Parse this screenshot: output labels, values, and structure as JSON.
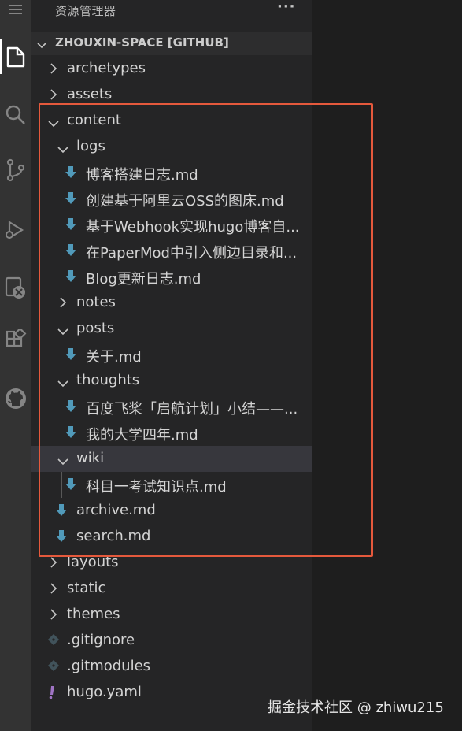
{
  "explorer": {
    "title": "资源管理器",
    "more_icon": "ellipsis-icon",
    "section_title": "ZHOUXIN-SPACE [GITHUB]"
  },
  "activity_bar": {
    "icons": [
      "menu-icon",
      "files-icon",
      "search-icon",
      "source-control-icon",
      "run-debug-icon",
      "remote-icon",
      "extensions-icon",
      "github-icon"
    ]
  },
  "tree": [
    {
      "name": "archetypes",
      "type": "folder",
      "expanded": false,
      "depth": 0
    },
    {
      "name": "assets",
      "type": "folder",
      "expanded": false,
      "depth": 0
    },
    {
      "name": "content",
      "type": "folder",
      "expanded": true,
      "depth": 0
    },
    {
      "name": "logs",
      "type": "folder",
      "expanded": true,
      "depth": 1
    },
    {
      "name": "博客搭建日志.md",
      "type": "md",
      "depth": 2
    },
    {
      "name": "创建基于阿里云OSS的图床.md",
      "type": "md",
      "depth": 2
    },
    {
      "name": "基于Webhook实现hugo博客自...",
      "type": "md",
      "depth": 2
    },
    {
      "name": "在PaperMod中引入侧边目录和...",
      "type": "md",
      "depth": 2
    },
    {
      "name": "Blog更新日志.md",
      "type": "md",
      "depth": 2
    },
    {
      "name": "notes",
      "type": "folder",
      "expanded": false,
      "depth": 1
    },
    {
      "name": "posts",
      "type": "folder",
      "expanded": true,
      "depth": 1
    },
    {
      "name": "关于.md",
      "type": "md",
      "depth": 2
    },
    {
      "name": "thoughts",
      "type": "folder",
      "expanded": true,
      "depth": 1
    },
    {
      "name": "百度飞桨「启航计划」小结——...",
      "type": "md",
      "depth": 2
    },
    {
      "name": "我的大学四年.md",
      "type": "md",
      "depth": 2
    },
    {
      "name": "wiki",
      "type": "folder",
      "expanded": true,
      "depth": 1,
      "selected": true
    },
    {
      "name": "科目一考试知识点.md",
      "type": "md",
      "depth": 2,
      "guide": true
    },
    {
      "name": "archive.md",
      "type": "md",
      "depth": 1
    },
    {
      "name": "search.md",
      "type": "md",
      "depth": 1
    },
    {
      "name": "layouts",
      "type": "folder",
      "expanded": false,
      "depth": 0
    },
    {
      "name": "static",
      "type": "folder",
      "expanded": false,
      "depth": 0
    },
    {
      "name": "themes",
      "type": "folder",
      "expanded": false,
      "depth": 0
    },
    {
      "name": ".gitignore",
      "type": "git",
      "depth": 0
    },
    {
      "name": ".gitmodules",
      "type": "git",
      "depth": 0
    },
    {
      "name": "hugo.yaml",
      "type": "yaml",
      "depth": 0
    }
  ],
  "colors": {
    "md_icon": "#519aba",
    "git_icon": "#41535b",
    "yaml_icon": "#a074c4",
    "highlight_border": "#e5593c"
  },
  "watermark": "掘金技术社区 @ zhiwu215"
}
